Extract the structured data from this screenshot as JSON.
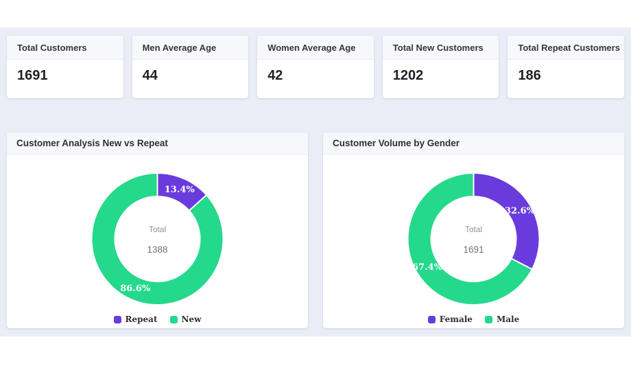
{
  "page": {
    "background": "#eaedf5",
    "card_background": "#ffffff",
    "card_header_background": "#f7f8fc"
  },
  "colors": {
    "purple": "#6a3bdc",
    "green": "#25d98c",
    "slice_border": "#ffffff"
  },
  "stat_cards": [
    {
      "label": "Total Customers",
      "value": "1691"
    },
    {
      "label": "Men Average Age",
      "value": "44"
    },
    {
      "label": "Women Average Age",
      "value": "42"
    },
    {
      "label": "Total New Customers",
      "value": "1202"
    },
    {
      "label": "Total Repeat Customers",
      "value": "186"
    }
  ],
  "chart_data": [
    {
      "type": "pie",
      "donut": true,
      "title": "Customer Analysis New vs Repeat",
      "center_label": "Total",
      "center_value": "1388",
      "legend_position": "bottom",
      "series": [
        {
          "name": "Repeat",
          "percent": 13.4,
          "color": "#6a3bdc"
        },
        {
          "name": "New",
          "percent": 86.6,
          "color": "#25d98c"
        }
      ]
    },
    {
      "type": "pie",
      "donut": true,
      "title": "Customer Volume by Gender",
      "center_label": "Total",
      "center_value": "1691",
      "legend_position": "bottom",
      "series": [
        {
          "name": "Female",
          "percent": 32.6,
          "color": "#6a3bdc"
        },
        {
          "name": "Male",
          "percent": 67.4,
          "color": "#25d98c"
        }
      ]
    }
  ]
}
